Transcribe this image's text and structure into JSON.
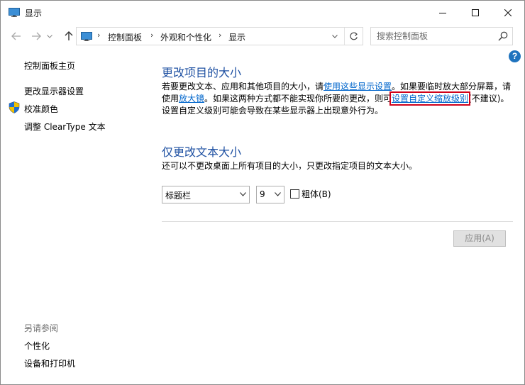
{
  "window": {
    "title": "显示",
    "accent_color": "#1e73be",
    "heading_color": "#1e50a2",
    "link_color": "#0066cc",
    "highlight_color": "#d0021b"
  },
  "nav": {
    "breadcrumbs": [
      "控制面板",
      "外观和个性化",
      "显示"
    ],
    "search_placeholder": "搜索控制面板"
  },
  "sidebar": {
    "home": "控制面板主页",
    "links": [
      "更改显示器设置",
      "校准颜色",
      "调整 ClearType 文本"
    ],
    "see_also_title": "另请参阅",
    "see_also": [
      "个性化",
      "设备和打印机"
    ]
  },
  "main": {
    "section1": {
      "title": "更改项目的大小",
      "l1_text1": "若要更改文本、应用和其他项目的大小，请",
      "l1_link": "使用这些显示设置",
      "l1_text2": "。如果要临时放大部分屏幕，请",
      "l2_text1": "使用",
      "l2_link1": "放大镜",
      "l2_text2": "。如果这两种方式都不能实现你所要的更改，则可",
      "l2_link2": "设置自定义缩放级别",
      "l2_text3": "(不建议)。",
      "l3_text": "设置自定义级别可能会导致在某些显示器上出现意外行为。"
    },
    "section2": {
      "title": "仅更改文本大小",
      "desc": "还可以不更改桌面上所有项目的大小，只更改指定项目的文本大小。",
      "element_select": "标题栏",
      "size_select": "9",
      "bold_label": "粗体(B)",
      "bold_checked": false
    },
    "apply_label": "应用(A)"
  }
}
